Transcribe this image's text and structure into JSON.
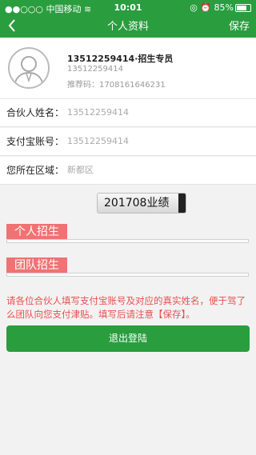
{
  "status_bar": {
    "carrier": "●●○○○ 中国移动",
    "time": "10:01",
    "battery": "85%"
  },
  "nav": {
    "back_icon": "chevron-left-icon",
    "title": "个人资料",
    "save_label": "保存"
  },
  "profile": {
    "avatar_icon": "user-avatar-icon",
    "display_name": "13512259414·招生专员",
    "phone": "13512259414",
    "referral": "推荐码：1708161646231"
  },
  "fields": [
    {
      "label": "合伙人姓名：",
      "value": "13512259414"
    },
    {
      "label": "支付宝账号：",
      "value": "13512259414"
    },
    {
      "label": "您所在区域：",
      "value": "新都区"
    }
  ],
  "summary_label": "201708业绩",
  "sections": {
    "personal": "个人招生",
    "team": "团队招生"
  },
  "notice": "请各位合伙人填写支付宝账号及对应的真实姓名，便于驾了么团队向您支付津贴。填写后请注意【保存】。",
  "logout_label": "退出登陆",
  "colors": {
    "brand": "#2a9d3f",
    "accent": "#f07272",
    "notice": "#e85050"
  }
}
